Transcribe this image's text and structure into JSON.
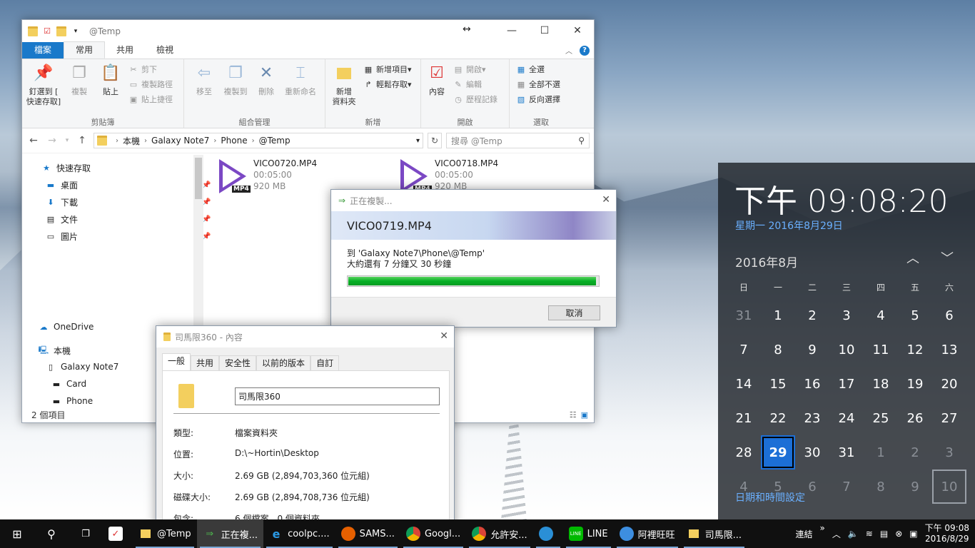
{
  "explorer": {
    "title": "@Temp",
    "ribbon_tabs": [
      "檔案",
      "常用",
      "共用",
      "檢視"
    ],
    "clipboard": {
      "pin": "釘選到 [\n快速存取]",
      "copy": "複製",
      "paste": "貼上",
      "cut": "剪下",
      "copy_path": "複製路徑",
      "paste_shortcut": "貼上捷徑",
      "label": "剪貼簿"
    },
    "organize": {
      "move": "移至",
      "copy_to": "複製到",
      "delete": "刪除",
      "rename": "重新命名",
      "label": "組合管理"
    },
    "new": {
      "new_folder": "新增\n資料夾",
      "new_item": "新增項目",
      "easy_access": "輕鬆存取",
      "label": "新增"
    },
    "open": {
      "properties": "內容",
      "open": "開啟",
      "edit": "編輯",
      "history": "歷程記錄",
      "label": "開啟"
    },
    "select": {
      "all": "全選",
      "none": "全部不選",
      "invert": "反向選擇",
      "label": "選取"
    },
    "breadcrumb": [
      "本機",
      "Galaxy Note7",
      "Phone",
      "@Temp"
    ],
    "search_placeholder": "搜尋 @Temp",
    "nav": {
      "quick_access": "快速存取",
      "desktop": "桌面",
      "downloads": "下載",
      "documents": "文件",
      "pictures": "圖片",
      "onedrive": "OneDrive",
      "this_pc": "本機",
      "device": "Galaxy Note7",
      "card": "Card",
      "phone": "Phone"
    },
    "files": [
      {
        "name": "VICO0720.MP4",
        "duration": "00:05:00",
        "size": "920 MB"
      },
      {
        "name": "VICO0718.MP4",
        "duration": "00:05:00",
        "size": "920 MB"
      }
    ],
    "status": "2 個項目"
  },
  "copy_dialog": {
    "title": "正在複製...",
    "file": "VICO0719.MP4",
    "dest": "到 'Galaxy Note7\\Phone\\@Temp'",
    "remaining": "大約還有 7 分鐘又 30 秒鐘",
    "progress": 0.99,
    "cancel": "取消"
  },
  "properties": {
    "title": "司馬限360 - 內容",
    "tabs": [
      "一般",
      "共用",
      "安全性",
      "以前的版本",
      "自訂"
    ],
    "name": "司馬限360",
    "rows": [
      {
        "label": "類型:",
        "value": "檔案資料夾"
      },
      {
        "label": "位置:",
        "value": "D:\\~Hortin\\Desktop"
      },
      {
        "label": "大小:",
        "value": "2.69 GB (2,894,703,360 位元組)"
      },
      {
        "label": "磁碟大小:",
        "value": "2.69 GB (2,894,708,736 位元組)"
      },
      {
        "label": "包含:",
        "value": "6 個檔案，0 個資料夾"
      }
    ]
  },
  "clock": {
    "time": "下午 09:08:20",
    "date": "星期一 2016年8月29日",
    "month": "2016年8月",
    "dows": [
      "日",
      "一",
      "二",
      "三",
      "四",
      "五",
      "六"
    ],
    "days": [
      "31",
      "1",
      "2",
      "3",
      "4",
      "5",
      "6",
      "7",
      "8",
      "9",
      "10",
      "11",
      "12",
      "13",
      "14",
      "15",
      "16",
      "17",
      "18",
      "19",
      "20",
      "21",
      "22",
      "23",
      "24",
      "25",
      "26",
      "27",
      "28",
      "29",
      "30",
      "31",
      "1",
      "2",
      "3",
      "4",
      "5",
      "6",
      "7",
      "8",
      "9",
      "10"
    ],
    "settings": "日期和時間設定"
  },
  "taskbar": {
    "items": [
      "@Temp",
      "正在複...",
      "coolpc....",
      "SAMS...",
      "Googl...",
      "允許安...",
      "",
      "LINE",
      "阿裡旺旺",
      "司馬限..."
    ],
    "link_label": "連結",
    "time": "下午 09:08",
    "date": "2016/8/29"
  }
}
